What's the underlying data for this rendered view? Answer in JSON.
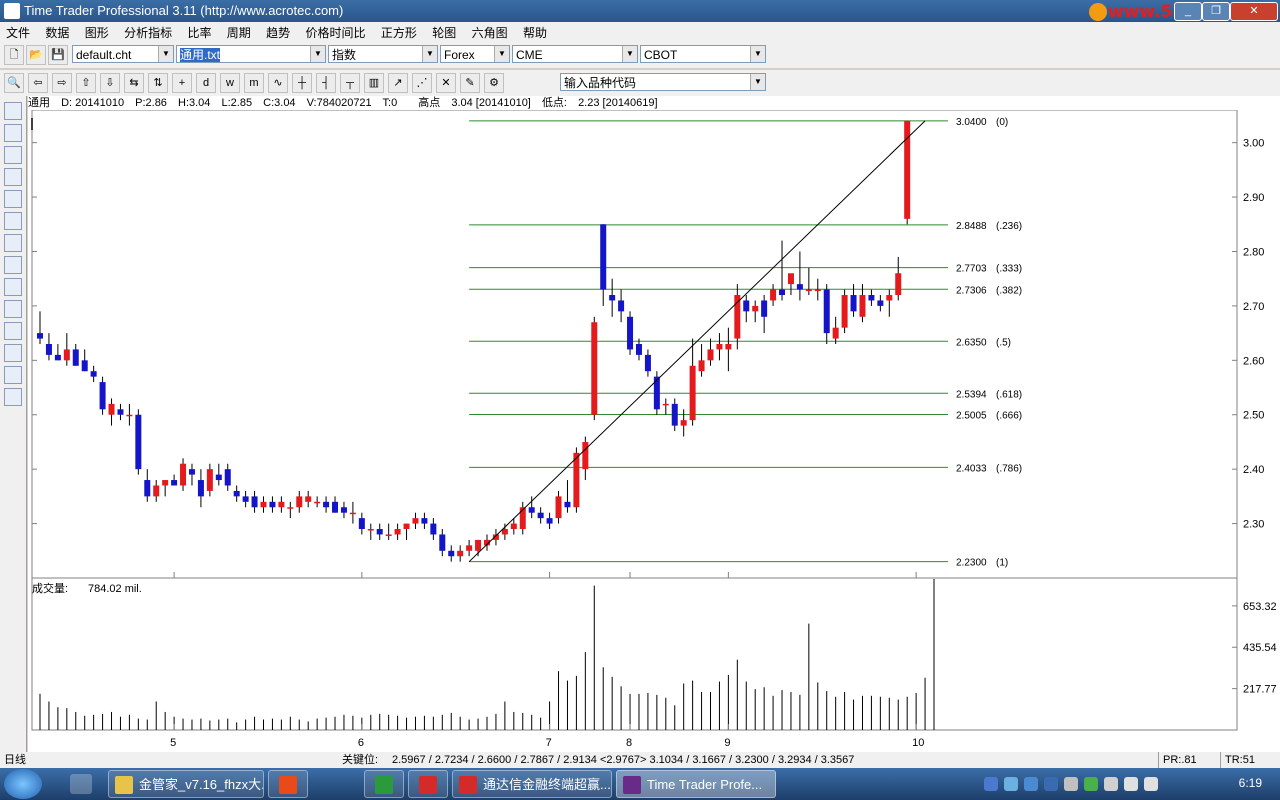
{
  "window": {
    "title": "Time Trader Professional 3.11 (http://www.acrotec.com)",
    "watermark": "www.55188.com",
    "minimize_label": "_",
    "restore_label": "❐",
    "close_label": "✕"
  },
  "menu": [
    "文件",
    "数据",
    "图形",
    "分析指标",
    "比率",
    "周期",
    "趋势",
    "价格时间比",
    "正方形",
    "轮图",
    "六角图",
    "帮助"
  ],
  "toolbar1": {
    "chart_file": "default.cht",
    "data_file": "通用.txt",
    "index_select": "指数",
    "market1": "Forex",
    "market2": "CME",
    "market3": "CBOT"
  },
  "toolbar2": {
    "symbol_placeholder": "输入品种代码",
    "buttons": [
      "🔍",
      "⇦",
      "⇨",
      "⇧",
      "⇩",
      "⇆",
      "⇅",
      "+",
      "d",
      "w",
      "m",
      "∿",
      "┼",
      "┤",
      "┬",
      "▥",
      "↗",
      "⋰",
      "✕",
      "✎",
      "⚙"
    ]
  },
  "info": {
    "symbol": "通用",
    "date": "D: 20141010",
    "p": "P:2.86",
    "h": "H:3.04",
    "l": "L:2.85",
    "c": "C:3.04",
    "v": "V:784020721",
    "t": "T:0",
    "high_label": "高点",
    "high_value": "3.04 [20141010]",
    "low_label": "低点:",
    "low_value": "2.23 [20140619]"
  },
  "volume_panel": {
    "label": "成交量:",
    "value": "784.02 mil."
  },
  "status": {
    "period": "日线",
    "keypoints_label": "关键位:",
    "keypoints": "2.5967 / 2.7234 / 2.6600 / 2.7867 / 2.9134 <2.9767> 3.1034 / 3.1667 / 3.2300 / 3.2934 / 3.3567",
    "pr": "PR:.81",
    "tr": "TR:51"
  },
  "taskbar": {
    "tasks": [
      "金管家_v7.16_fhzx大...",
      "",
      "",
      "通达信金融终端超赢...",
      "Time Trader Profe..."
    ],
    "clock": "6:19"
  },
  "colors": {
    "up": "#e41a1c",
    "down": "#1414c8",
    "fib": "#2e8b2e",
    "volume": "#000000"
  },
  "chart_data": {
    "type": "candlestick",
    "x_tick_labels": [
      "5",
      "6",
      "7",
      "8",
      "9",
      "10"
    ],
    "x_tick_bar_index": [
      15,
      36,
      57,
      66,
      77,
      98
    ],
    "y_ticks": [
      2.3,
      2.4,
      2.5,
      2.6,
      2.7,
      2.8,
      2.9,
      3.0
    ],
    "y_tick_labels": [
      "2.30",
      "2.40",
      "2.50",
      "2.60",
      "2.70",
      "2.80",
      "2.90",
      "3.00"
    ],
    "ylim": [
      2.2,
      3.06
    ],
    "fib_levels": [
      {
        "price": 3.04,
        "label": "3.0400",
        "ratio": "(0)"
      },
      {
        "price": 2.8488,
        "label": "2.8488",
        "ratio": "(.236)"
      },
      {
        "price": 2.7703,
        "label": "2.7703",
        "ratio": "(.333)"
      },
      {
        "price": 2.7306,
        "label": "2.7306",
        "ratio": "(.382)"
      },
      {
        "price": 2.635,
        "label": "2.6350",
        "ratio": "(.5)"
      },
      {
        "price": 2.5394,
        "label": "2.5394",
        "ratio": "(.618)"
      },
      {
        "price": 2.5005,
        "label": "2.5005",
        "ratio": "(.666)"
      },
      {
        "price": 2.4033,
        "label": "2.4033",
        "ratio": "(.786)"
      },
      {
        "price": 2.23,
        "label": "2.2300",
        "ratio": "(1)"
      }
    ],
    "fib_start_bar": 48,
    "trendline": {
      "from": [
        48,
        2.23
      ],
      "to": [
        99,
        3.04
      ]
    },
    "volume_ticks": [
      217.77,
      435.54,
      653.32
    ],
    "volume_tick_labels": [
      "217.77",
      "435.54",
      "653.32"
    ],
    "volume_max": 800,
    "candles": [
      {
        "o": 2.65,
        "h": 2.69,
        "l": 2.63,
        "c": 2.64
      },
      {
        "o": 2.63,
        "h": 2.65,
        "l": 2.6,
        "c": 2.61
      },
      {
        "o": 2.61,
        "h": 2.63,
        "l": 2.6,
        "c": 2.6
      },
      {
        "o": 2.6,
        "h": 2.65,
        "l": 2.59,
        "c": 2.62
      },
      {
        "o": 2.62,
        "h": 2.63,
        "l": 2.59,
        "c": 2.59
      },
      {
        "o": 2.6,
        "h": 2.62,
        "l": 2.58,
        "c": 2.58
      },
      {
        "o": 2.58,
        "h": 2.59,
        "l": 2.56,
        "c": 2.57
      },
      {
        "o": 2.56,
        "h": 2.57,
        "l": 2.5,
        "c": 2.51
      },
      {
        "o": 2.5,
        "h": 2.53,
        "l": 2.48,
        "c": 2.52
      },
      {
        "o": 2.51,
        "h": 2.52,
        "l": 2.49,
        "c": 2.5
      },
      {
        "o": 2.5,
        "h": 2.52,
        "l": 2.48,
        "c": 2.5
      },
      {
        "o": 2.5,
        "h": 2.51,
        "l": 2.39,
        "c": 2.4
      },
      {
        "o": 2.38,
        "h": 2.4,
        "l": 2.34,
        "c": 2.35
      },
      {
        "o": 2.35,
        "h": 2.38,
        "l": 2.34,
        "c": 2.37
      },
      {
        "o": 2.37,
        "h": 2.38,
        "l": 2.35,
        "c": 2.38
      },
      {
        "o": 2.38,
        "h": 2.39,
        "l": 2.37,
        "c": 2.37
      },
      {
        "o": 2.37,
        "h": 2.42,
        "l": 2.36,
        "c": 2.41
      },
      {
        "o": 2.4,
        "h": 2.41,
        "l": 2.37,
        "c": 2.39
      },
      {
        "o": 2.38,
        "h": 2.4,
        "l": 2.33,
        "c": 2.35
      },
      {
        "o": 2.36,
        "h": 2.41,
        "l": 2.35,
        "c": 2.4
      },
      {
        "o": 2.39,
        "h": 2.41,
        "l": 2.37,
        "c": 2.38
      },
      {
        "o": 2.4,
        "h": 2.41,
        "l": 2.36,
        "c": 2.37
      },
      {
        "o": 2.36,
        "h": 2.37,
        "l": 2.34,
        "c": 2.35
      },
      {
        "o": 2.35,
        "h": 2.36,
        "l": 2.33,
        "c": 2.34
      },
      {
        "o": 2.35,
        "h": 2.36,
        "l": 2.32,
        "c": 2.33
      },
      {
        "o": 2.33,
        "h": 2.35,
        "l": 2.32,
        "c": 2.34
      },
      {
        "o": 2.34,
        "h": 2.35,
        "l": 2.32,
        "c": 2.33
      },
      {
        "o": 2.33,
        "h": 2.35,
        "l": 2.32,
        "c": 2.34
      },
      {
        "o": 2.33,
        "h": 2.34,
        "l": 2.31,
        "c": 2.33
      },
      {
        "o": 2.33,
        "h": 2.36,
        "l": 2.32,
        "c": 2.35
      },
      {
        "o": 2.34,
        "h": 2.36,
        "l": 2.33,
        "c": 2.35
      },
      {
        "o": 2.34,
        "h": 2.35,
        "l": 2.33,
        "c": 2.34
      },
      {
        "o": 2.34,
        "h": 2.35,
        "l": 2.32,
        "c": 2.33
      },
      {
        "o": 2.34,
        "h": 2.35,
        "l": 2.32,
        "c": 2.32
      },
      {
        "o": 2.33,
        "h": 2.34,
        "l": 2.31,
        "c": 2.32
      },
      {
        "o": 2.32,
        "h": 2.34,
        "l": 2.3,
        "c": 2.32
      },
      {
        "o": 2.31,
        "h": 2.32,
        "l": 2.28,
        "c": 2.29
      },
      {
        "o": 2.29,
        "h": 2.3,
        "l": 2.27,
        "c": 2.29
      },
      {
        "o": 2.29,
        "h": 2.3,
        "l": 2.27,
        "c": 2.28
      },
      {
        "o": 2.28,
        "h": 2.3,
        "l": 2.27,
        "c": 2.28
      },
      {
        "o": 2.28,
        "h": 2.3,
        "l": 2.27,
        "c": 2.29
      },
      {
        "o": 2.29,
        "h": 2.3,
        "l": 2.27,
        "c": 2.3
      },
      {
        "o": 2.3,
        "h": 2.32,
        "l": 2.29,
        "c": 2.31
      },
      {
        "o": 2.31,
        "h": 2.32,
        "l": 2.29,
        "c": 2.3
      },
      {
        "o": 2.3,
        "h": 2.31,
        "l": 2.27,
        "c": 2.28
      },
      {
        "o": 2.28,
        "h": 2.29,
        "l": 2.24,
        "c": 2.25
      },
      {
        "o": 2.25,
        "h": 2.26,
        "l": 2.23,
        "c": 2.24
      },
      {
        "o": 2.24,
        "h": 2.26,
        "l": 2.23,
        "c": 2.25
      },
      {
        "o": 2.25,
        "h": 2.27,
        "l": 2.24,
        "c": 2.26
      },
      {
        "o": 2.25,
        "h": 2.27,
        "l": 2.24,
        "c": 2.27
      },
      {
        "o": 2.26,
        "h": 2.28,
        "l": 2.25,
        "c": 2.27
      },
      {
        "o": 2.27,
        "h": 2.29,
        "l": 2.26,
        "c": 2.28
      },
      {
        "o": 2.28,
        "h": 2.3,
        "l": 2.27,
        "c": 2.29
      },
      {
        "o": 2.29,
        "h": 2.31,
        "l": 2.28,
        "c": 2.3
      },
      {
        "o": 2.29,
        "h": 2.34,
        "l": 2.28,
        "c": 2.33
      },
      {
        "o": 2.33,
        "h": 2.35,
        "l": 2.31,
        "c": 2.32
      },
      {
        "o": 2.32,
        "h": 2.33,
        "l": 2.3,
        "c": 2.31
      },
      {
        "o": 2.31,
        "h": 2.32,
        "l": 2.29,
        "c": 2.3
      },
      {
        "o": 2.31,
        "h": 2.36,
        "l": 2.3,
        "c": 2.35
      },
      {
        "o": 2.34,
        "h": 2.38,
        "l": 2.32,
        "c": 2.33
      },
      {
        "o": 2.33,
        "h": 2.44,
        "l": 2.32,
        "c": 2.43
      },
      {
        "o": 2.4,
        "h": 2.46,
        "l": 2.38,
        "c": 2.45
      },
      {
        "o": 2.5,
        "h": 2.68,
        "l": 2.49,
        "c": 2.67
      },
      {
        "o": 2.85,
        "h": 2.85,
        "l": 2.7,
        "c": 2.73
      },
      {
        "o": 2.72,
        "h": 2.75,
        "l": 2.68,
        "c": 2.71
      },
      {
        "o": 2.71,
        "h": 2.73,
        "l": 2.67,
        "c": 2.69
      },
      {
        "o": 2.68,
        "h": 2.69,
        "l": 2.61,
        "c": 2.62
      },
      {
        "o": 2.63,
        "h": 2.64,
        "l": 2.6,
        "c": 2.61
      },
      {
        "o": 2.61,
        "h": 2.62,
        "l": 2.57,
        "c": 2.58
      },
      {
        "o": 2.57,
        "h": 2.58,
        "l": 2.5,
        "c": 2.51
      },
      {
        "o": 2.52,
        "h": 2.53,
        "l": 2.5,
        "c": 2.52
      },
      {
        "o": 2.52,
        "h": 2.53,
        "l": 2.47,
        "c": 2.48
      },
      {
        "o": 2.48,
        "h": 2.51,
        "l": 2.46,
        "c": 2.49
      },
      {
        "o": 2.49,
        "h": 2.64,
        "l": 2.48,
        "c": 2.59
      },
      {
        "o": 2.58,
        "h": 2.63,
        "l": 2.57,
        "c": 2.6
      },
      {
        "o": 2.6,
        "h": 2.64,
        "l": 2.59,
        "c": 2.62
      },
      {
        "o": 2.62,
        "h": 2.65,
        "l": 2.6,
        "c": 2.63
      },
      {
        "o": 2.62,
        "h": 2.66,
        "l": 2.58,
        "c": 2.63
      },
      {
        "o": 2.64,
        "h": 2.74,
        "l": 2.62,
        "c": 2.72
      },
      {
        "o": 2.71,
        "h": 2.72,
        "l": 2.67,
        "c": 2.69
      },
      {
        "o": 2.69,
        "h": 2.71,
        "l": 2.67,
        "c": 2.7
      },
      {
        "o": 2.71,
        "h": 2.72,
        "l": 2.65,
        "c": 2.68
      },
      {
        "o": 2.71,
        "h": 2.74,
        "l": 2.7,
        "c": 2.73
      },
      {
        "o": 2.73,
        "h": 2.82,
        "l": 2.71,
        "c": 2.72
      },
      {
        "o": 2.74,
        "h": 2.75,
        "l": 2.72,
        "c": 2.76
      },
      {
        "o": 2.74,
        "h": 2.8,
        "l": 2.71,
        "c": 2.73
      },
      {
        "o": 2.73,
        "h": 2.77,
        "l": 2.72,
        "c": 2.73
      },
      {
        "o": 2.73,
        "h": 2.75,
        "l": 2.71,
        "c": 2.73
      },
      {
        "o": 2.73,
        "h": 2.74,
        "l": 2.63,
        "c": 2.65
      },
      {
        "o": 2.64,
        "h": 2.68,
        "l": 2.63,
        "c": 2.66
      },
      {
        "o": 2.66,
        "h": 2.73,
        "l": 2.65,
        "c": 2.72
      },
      {
        "o": 2.72,
        "h": 2.74,
        "l": 2.68,
        "c": 2.69
      },
      {
        "o": 2.68,
        "h": 2.74,
        "l": 2.67,
        "c": 2.72
      },
      {
        "o": 2.72,
        "h": 2.73,
        "l": 2.7,
        "c": 2.71
      },
      {
        "o": 2.71,
        "h": 2.72,
        "l": 2.69,
        "c": 2.7
      },
      {
        "o": 2.71,
        "h": 2.73,
        "l": 2.68,
        "c": 2.72
      },
      {
        "o": 2.72,
        "h": 2.79,
        "l": 2.71,
        "c": 2.76
      },
      {
        "o": 2.86,
        "h": 3.04,
        "l": 2.85,
        "c": 3.04
      }
    ],
    "volume": [
      190,
      150,
      120,
      115,
      95,
      75,
      80,
      85,
      95,
      70,
      80,
      60,
      55,
      150,
      95,
      70,
      60,
      55,
      60,
      50,
      55,
      60,
      40,
      55,
      70,
      55,
      60,
      55,
      70,
      55,
      45,
      60,
      65,
      70,
      80,
      75,
      65,
      80,
      85,
      80,
      75,
      65,
      70,
      75,
      70,
      80,
      90,
      70,
      55,
      60,
      70,
      85,
      150,
      95,
      90,
      80,
      65,
      150,
      310,
      260,
      285,
      410,
      760,
      330,
      280,
      230,
      190,
      190,
      195,
      185,
      170,
      130,
      245,
      260,
      200,
      200,
      255,
      290,
      370,
      255,
      215,
      225,
      180,
      210,
      200,
      185,
      560,
      250,
      205,
      175,
      200,
      160,
      180,
      180,
      175,
      170,
      160,
      175,
      195,
      275,
      795
    ]
  }
}
